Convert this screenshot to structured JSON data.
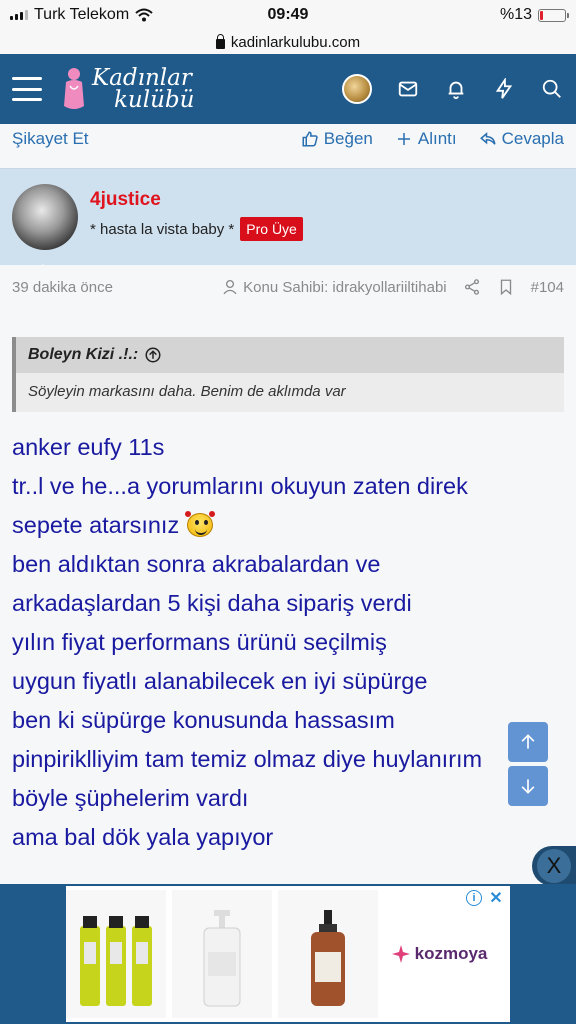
{
  "status": {
    "carrier": "Turk Telekom",
    "time": "09:49",
    "battery": "%13",
    "battery_level": 0.13
  },
  "browser": {
    "url": "kadinlarkulubu.com"
  },
  "header": {
    "logo_line1": "Kadınlar",
    "logo_line2": "kulübü",
    "icons": [
      "menu-icon",
      "avatar",
      "mail-icon",
      "bell-icon",
      "bolt-icon",
      "search-icon"
    ]
  },
  "actions": {
    "report": "Şikayet Et",
    "like": "Beğen",
    "quote": "Alıntı",
    "reply": "Cevapla"
  },
  "post": {
    "username": "4justice",
    "user_title": "* hasta la vista baby *",
    "badge": "Pro Üye",
    "time": "39 dakika önce",
    "thread_starter": "Konu Sahibi: idrakyollariiltihabi",
    "post_number": "#104"
  },
  "quote": {
    "author": "Boleyn Kizi .!.:",
    "text": "Söyleyin markasını daha. Benim de aklımda var"
  },
  "content": {
    "lines": [
      "anker eufy 11s",
      "tr..l ve he...a yorumlarını okuyun zaten direk",
      "sepete atarsınız",
      "ben aldıktan sonra akrabalardan ve",
      "arkadaşlardan 5 kişi daha sipariş verdi",
      "yılın fiyat performans ürünü seçilmiş",
      "uygun fiyatlı alanabilecek en iyi süpürge",
      "ben ki süpürge konusunda hassasım",
      "pinpiriklliyim tam temiz olmaz diye huylanırım",
      "böyle şüphelerim vardı",
      "ama bal dök yala yapıyor"
    ]
  },
  "ad": {
    "close": "X",
    "brand": "kozmoya"
  }
}
